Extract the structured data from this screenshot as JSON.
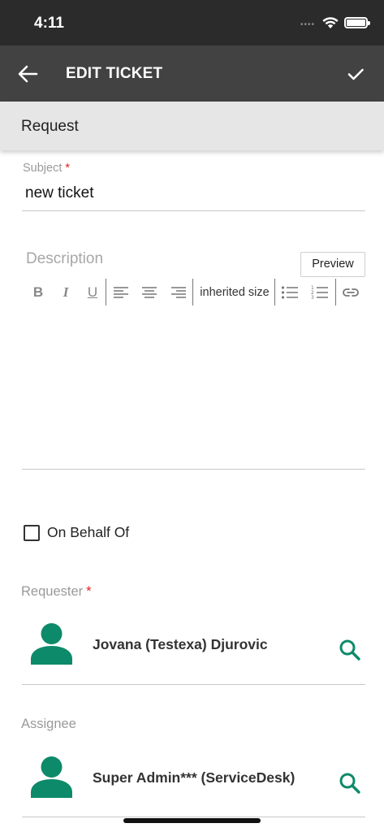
{
  "status_bar": {
    "time": "4:11"
  },
  "app_bar": {
    "title": "EDIT TICKET"
  },
  "section": {
    "title": "Request"
  },
  "subject": {
    "label": "Subject",
    "required_mark": "*",
    "value": "new ticket"
  },
  "description": {
    "label": "Description",
    "preview_label": "Preview",
    "toolbar": {
      "bold": "B",
      "italic": "I",
      "underline": "U",
      "font_size": "inherited size"
    }
  },
  "on_behalf_of": {
    "label": "On Behalf Of",
    "checked": false
  },
  "requester": {
    "label": "Requester",
    "required_mark": "*",
    "name": "Jovana (Testexa) Djurovic"
  },
  "assignee": {
    "label": "Assignee",
    "name": "Super Admin*** (ServiceDesk)"
  },
  "colors": {
    "app_bar": "#424242",
    "status_bar": "#2b2b2b",
    "section_header": "#e6e6e6",
    "accent": "#0d8a6a",
    "required": "#e02020"
  },
  "icons": [
    "back-arrow-icon",
    "checkmark-icon",
    "wifi-icon",
    "battery-icon",
    "align-left-icon",
    "align-center-icon",
    "align-right-icon",
    "bulleted-list-icon",
    "numbered-list-icon",
    "link-icon",
    "person-icon",
    "search-icon"
  ]
}
